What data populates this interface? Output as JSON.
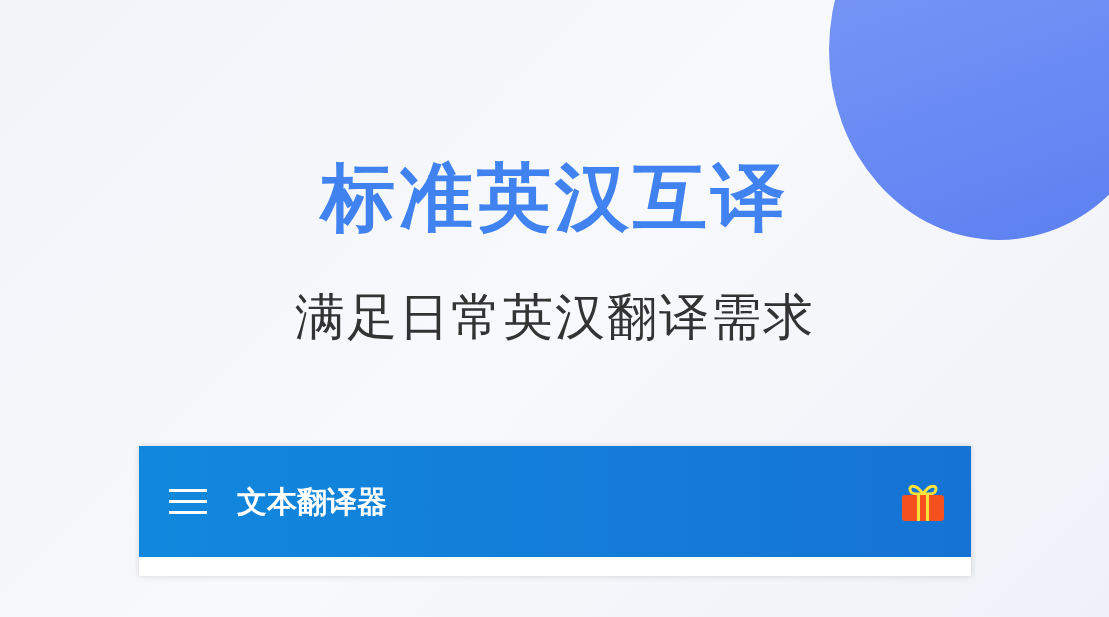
{
  "headline": "标准英汉互译",
  "subtitle": "满足日常英汉翻译需求",
  "app_bar": {
    "title": "文本翻译器"
  }
}
